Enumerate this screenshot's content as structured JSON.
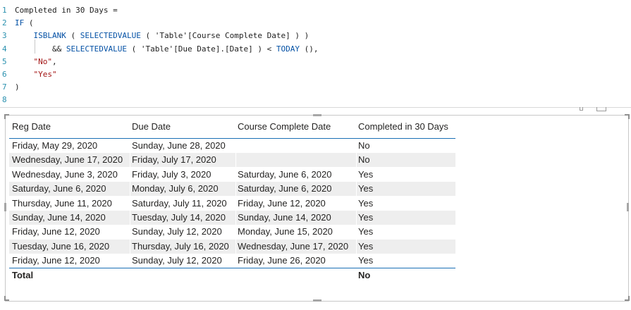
{
  "editor": {
    "lines": [
      {
        "num": "1",
        "parts": [
          {
            "t": "Completed in 30 Days =",
            "c": ""
          }
        ]
      },
      {
        "num": "2",
        "parts": [
          {
            "t": "IF",
            "c": "kw"
          },
          {
            "t": " (",
            "c": ""
          }
        ]
      },
      {
        "num": "3",
        "parts": [
          {
            "t": "    ",
            "c": ""
          },
          {
            "t": "ISBLANK",
            "c": "fn"
          },
          {
            "t": " ( ",
            "c": ""
          },
          {
            "t": "SELECTEDVALUE",
            "c": "fn"
          },
          {
            "t": " ( 'Table'[Course Complete Date] ) )",
            "c": ""
          }
        ]
      },
      {
        "num": "4",
        "parts": [
          {
            "t": "        && ",
            "c": ""
          },
          {
            "t": "SELECTEDVALUE",
            "c": "fn"
          },
          {
            "t": " ( 'Table'[Due Date].[Date] ) < ",
            "c": ""
          },
          {
            "t": "TODAY",
            "c": "fn"
          },
          {
            "t": " (),",
            "c": ""
          }
        ]
      },
      {
        "num": "5",
        "parts": [
          {
            "t": "    ",
            "c": ""
          },
          {
            "t": "\"No\"",
            "c": "str"
          },
          {
            "t": ",",
            "c": ""
          }
        ]
      },
      {
        "num": "6",
        "parts": [
          {
            "t": "    ",
            "c": ""
          },
          {
            "t": "\"Yes\"",
            "c": "str"
          }
        ]
      },
      {
        "num": "7",
        "parts": [
          {
            "t": ")",
            "c": ""
          }
        ]
      },
      {
        "num": "8",
        "parts": [
          {
            "t": "",
            "c": ""
          }
        ]
      }
    ]
  },
  "table": {
    "headers": [
      "Reg Date",
      "Due Date",
      "Course Complete Date",
      "Completed in 30 Days"
    ],
    "rows": [
      [
        "Friday, May 29, 2020",
        "Sunday, June 28, 2020",
        "",
        "No"
      ],
      [
        "Wednesday, June 17, 2020",
        "Friday, July 17, 2020",
        "",
        "No"
      ],
      [
        "Wednesday, June 3, 2020",
        "Friday, July 3, 2020",
        "Saturday, June 6, 2020",
        "Yes"
      ],
      [
        "Saturday, June 6, 2020",
        "Monday, July 6, 2020",
        "Saturday, June 6, 2020",
        "Yes"
      ],
      [
        "Thursday, June 11, 2020",
        "Saturday, July 11, 2020",
        "Friday, June 12, 2020",
        "Yes"
      ],
      [
        "Sunday, June 14, 2020",
        "Tuesday, July 14, 2020",
        "Sunday, June 14, 2020",
        "Yes"
      ],
      [
        "Friday, June 12, 2020",
        "Sunday, July 12, 2020",
        "Monday, June 15, 2020",
        "Yes"
      ],
      [
        "Tuesday, June 16, 2020",
        "Thursday, July 16, 2020",
        "Wednesday, June 17, 2020",
        "Yes"
      ],
      [
        "Friday, June 12, 2020",
        "Sunday, July 12, 2020",
        "Friday, June 26, 2020",
        "Yes"
      ]
    ],
    "total": [
      "Total",
      "",
      "",
      "No"
    ]
  },
  "colors": {
    "line_number": "#2b91af",
    "keyword": "#0451a5",
    "string": "#a31515",
    "table_accent": "#1a6fb5",
    "alt_row": "#eeeeee"
  },
  "icons": [
    "focus-mode-icon",
    "more-options-icon"
  ]
}
